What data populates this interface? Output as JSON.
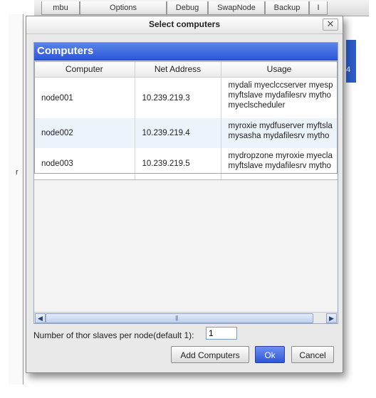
{
  "background": {
    "tabs": [
      "mbu",
      "Options",
      "Debug",
      "SwapNode",
      "Backup",
      "I"
    ],
    "left_char": "r",
    "right_char": "4"
  },
  "dialog": {
    "title": "Select computers",
    "close_label": "✕"
  },
  "panel": {
    "title": "Computers",
    "columns": [
      "Computer",
      "Net Address",
      "Usage"
    ],
    "rows": [
      {
        "computer": "node001",
        "address": "10.239.219.3",
        "usage": [
          "mydali myeclccserver myesp",
          "myftslave mydafilesrv mytho",
          "myeclscheduler"
        ]
      },
      {
        "computer": "node002",
        "address": "10.239.219.4",
        "usage": [
          "myroxie mydfuserver myftsla",
          "mysasha mydafilesrv mytho"
        ]
      },
      {
        "computer": "node003",
        "address": "10.239.219.5",
        "usage": [
          "mydropzone myroxie myecla",
          "myftslave mydafilesrv mytho"
        ]
      }
    ]
  },
  "form": {
    "slaves_label": "Number of thor slaves per node(default 1):",
    "slaves_value": "1"
  },
  "buttons": {
    "add": "Add Computers",
    "ok": "Ok",
    "cancel": "Cancel"
  }
}
